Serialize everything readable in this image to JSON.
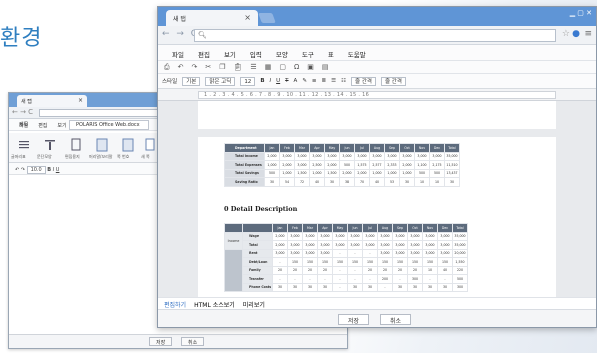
{
  "background": {
    "title": "환경",
    "accent": "#2f7fc0"
  },
  "back_window": {
    "tab_title": "새 탭",
    "menu": [
      "파일",
      "편집",
      "보기",
      "입력",
      "모양",
      "도구"
    ],
    "doc_title_label": "제목",
    "doc_title": "POLARIS Office Web.docx",
    "ribbon": [
      "글머리표",
      "문단모양",
      "편집용지",
      "머리말/꼬리말",
      "쪽 번호",
      "새 쪽",
      "쪽 나누기"
    ],
    "font_size": "10.0",
    "buttons": {
      "save": "저장",
      "cancel": "취소"
    }
  },
  "front_window": {
    "tab_title": "새 탭",
    "url": "",
    "menu": [
      "파일",
      "편집",
      "보기",
      "입력",
      "모양",
      "도구",
      "표",
      "도움말"
    ],
    "format": {
      "style": "스타일",
      "style_value": "기본",
      "font": "맑은 고딕",
      "size": "12",
      "paragraph_spacing": "줄 간격",
      "line_spacing": "줄 간격"
    },
    "ruler": "1 . 2 . 3 . 4 . 5 . 6 . 7 . 8 . 9 . 10 . 11 . 12 . 13 . 14 . 15 . 16",
    "table1": {
      "header_label": "Department",
      "months": [
        "Jan",
        "Feb",
        "Mar",
        "Apr",
        "May",
        "Jun",
        "Jul",
        "Aug",
        "Sep",
        "Oct",
        "Nov",
        "Dec",
        "Total"
      ],
      "rows": [
        {
          "label": "Total Income",
          "values": [
            "2,000",
            "3,000",
            "3,000",
            "3,000",
            "3,000",
            "3,000",
            "3,000",
            "3,000",
            "3,000",
            "3,000",
            "3,000",
            "3,000",
            "35,000"
          ]
        },
        {
          "label": "Total Expenses",
          "values": [
            "1,000",
            "2,000",
            "3,000",
            "2,500",
            "2,000",
            "500",
            "1,575",
            "2,577",
            "2,333",
            "2,000",
            "1,100",
            "2,175",
            "11,510"
          ]
        },
        {
          "label": "Total Savings",
          "values": [
            "500",
            "1,000",
            "1,500",
            "1,000",
            "1,500",
            "2,000",
            "2,000",
            "1,000",
            "1,000",
            "1,000",
            "500",
            "500",
            "13,437"
          ]
        },
        {
          "label": "Saving Ratio",
          "values": [
            "30",
            "54",
            "72",
            "40",
            "30",
            "38",
            "70",
            "40",
            "53",
            "30",
            "10",
            "10",
            "30"
          ]
        }
      ]
    },
    "detail_heading": "0 Detail Description",
    "table2": {
      "group_label": "Income",
      "months": [
        "Jan",
        "Feb",
        "Mar",
        "Apr",
        "May",
        "Jun",
        "Jul",
        "Aug",
        "Sep",
        "Oct",
        "Nov",
        "Dec",
        "Total"
      ],
      "income_rows": [
        {
          "label": "Wage",
          "values": [
            "2,000",
            "3,000",
            "3,000",
            "3,000",
            "3,000",
            "3,000",
            "3,000",
            "3,000",
            "3,000",
            "3,000",
            "3,000",
            "3,000",
            "35,000"
          ]
        },
        {
          "label": "Total",
          "values": [
            "2,000",
            "3,000",
            "3,000",
            "3,000",
            "3,000",
            "3,000",
            "3,000",
            "3,000",
            "3,000",
            "3,000",
            "3,000",
            "3,000",
            "35,000"
          ]
        }
      ],
      "expense_rows": [
        {
          "label": "Rent",
          "values": [
            "3,000",
            "3,000",
            "3,000",
            "3,000",
            "-",
            "-",
            "-",
            "3,000",
            "3,000",
            "3,000",
            "3,000",
            "3,000",
            "20,000"
          ]
        },
        {
          "label": "Debt/Loan",
          "values": [
            "-",
            "150",
            "150",
            "150",
            "150",
            "150",
            "150",
            "150",
            "150",
            "150",
            "150",
            "150",
            "1,550"
          ]
        },
        {
          "label": "Family",
          "values": [
            "20",
            "20",
            "20",
            "20",
            "-",
            "-",
            "20",
            "20",
            "20",
            "20",
            "10",
            "40",
            "220"
          ]
        },
        {
          "label": "Transfer",
          "values": [
            "-",
            "-",
            "-",
            "-",
            "-",
            "-",
            "-",
            "200",
            "-",
            "300",
            "-",
            "-",
            "500"
          ]
        },
        {
          "label": "Phone Costs",
          "values": [
            "30",
            "30",
            "30",
            "30",
            "-",
            "30",
            "30",
            "-",
            "30",
            "30",
            "30",
            "30",
            "300"
          ]
        }
      ]
    },
    "modes": [
      "편집하기",
      "HTML 소스보기",
      "미리보기"
    ],
    "buttons": {
      "save": "저장",
      "cancel": "취소"
    }
  }
}
